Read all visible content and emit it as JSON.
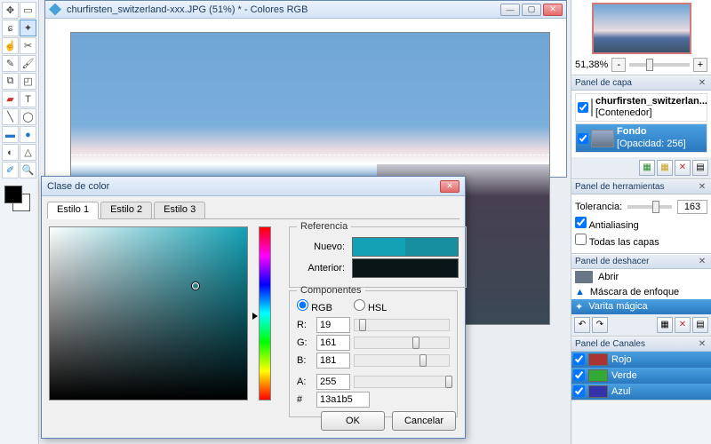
{
  "doc": {
    "title": "churfirsten_switzerland-xxx.JPG (51%) * - Colores RGB"
  },
  "dialog": {
    "title": "Clase de color",
    "tabs": [
      "Estilo 1",
      "Estilo 2",
      "Estilo 3"
    ],
    "reference": {
      "legend": "Referencia",
      "new_label": "Nuevo:",
      "prev_label": "Anterior:",
      "new_color": "#13a1b5",
      "prev_color": "#0a1518"
    },
    "components": {
      "legend": "Componentes",
      "mode_rgb": "RGB",
      "mode_hsl": "HSL",
      "labels": {
        "r": "R:",
        "g": "G:",
        "b": "B:",
        "a": "A:",
        "hex": "#"
      },
      "r": "19",
      "g": "161",
      "b": "181",
      "a": "255",
      "hex": "13a1b5"
    },
    "ok": "OK",
    "cancel": "Cancelar"
  },
  "zoom": {
    "value": "51,38%",
    "minus": "-",
    "plus": "+"
  },
  "layers": {
    "title": "Panel de capa",
    "item0": {
      "name": "churfirsten_switzerlan...",
      "sub": "[Contenedor]"
    },
    "item1": {
      "name": "Fondo",
      "sub": "[Opacidad: 256]"
    }
  },
  "tools": {
    "title": "Panel de herramientas",
    "tolerance_label": "Tolerancia:",
    "tolerance": "163",
    "antialias": "Antialiasing",
    "alllayers": "Todas las capas"
  },
  "undo": {
    "title": "Panel de deshacer",
    "items": [
      "Abrir",
      "Máscara de enfoque",
      "Varita mágica"
    ]
  },
  "channels": {
    "title": "Panel de Canales",
    "r": "Rojo",
    "g": "Verde",
    "b": "Azul"
  }
}
